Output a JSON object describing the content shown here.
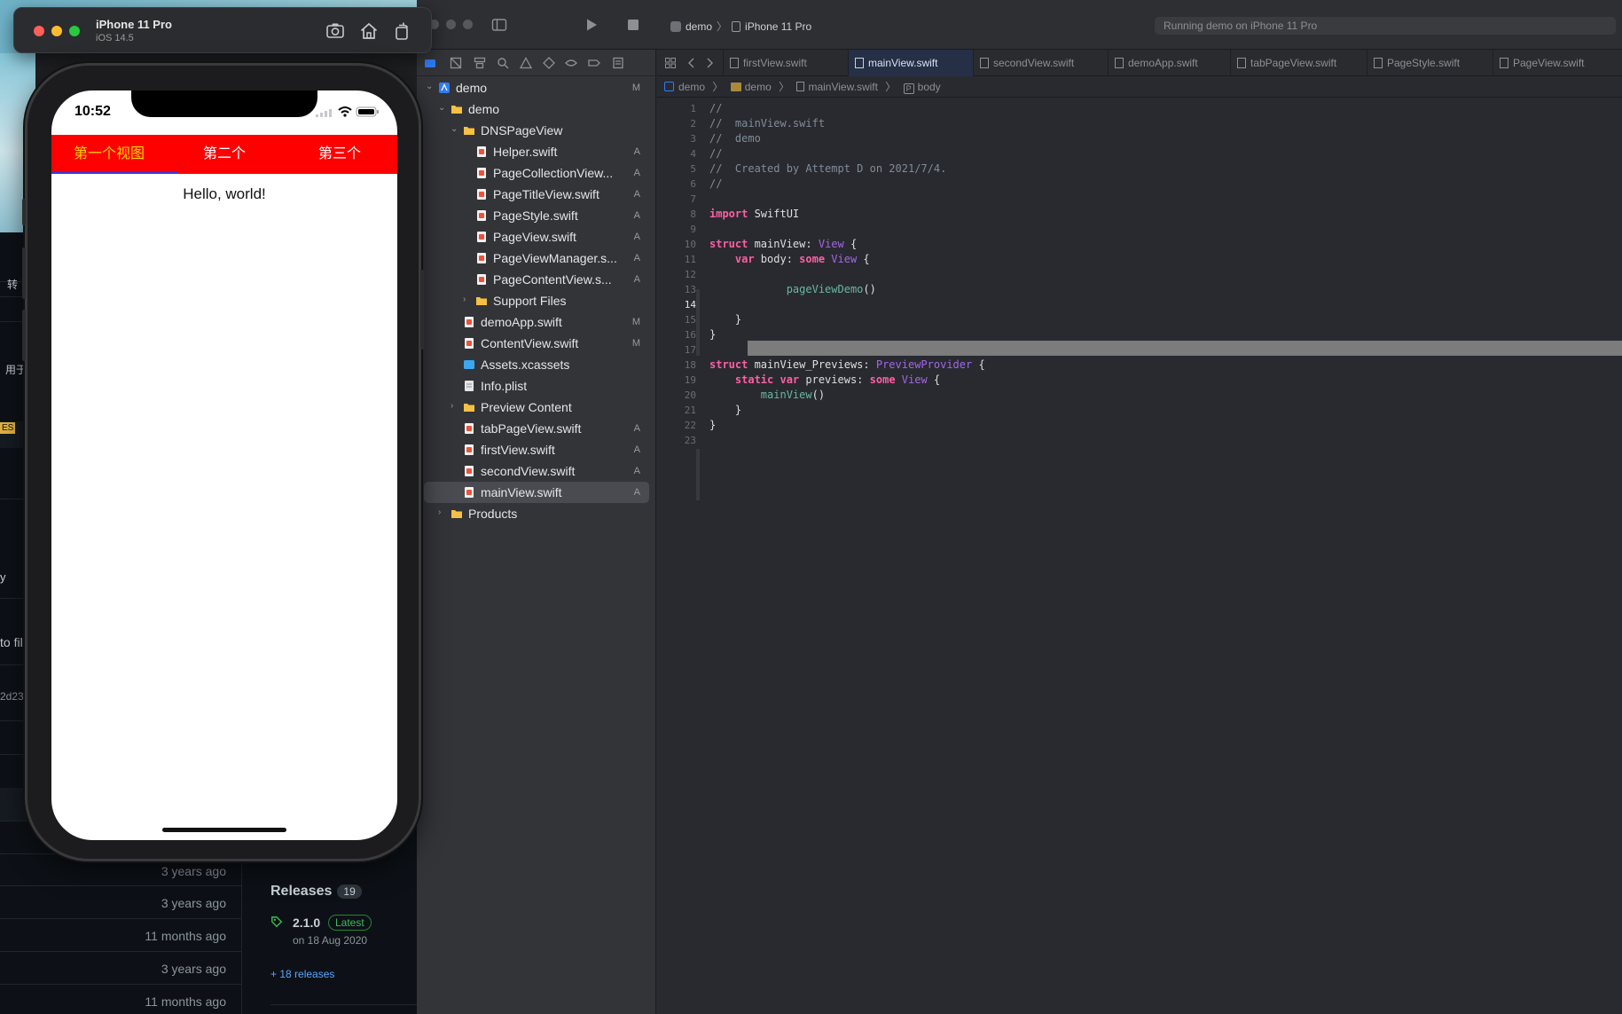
{
  "simulator": {
    "device_name": "iPhone 11 Pro",
    "os_version": "iOS 14.5",
    "status_time": "10:52",
    "tabs": [
      {
        "label": "第一个视图"
      },
      {
        "label": "第二个"
      },
      {
        "label": "第三个"
      }
    ],
    "content_text": "Hello, world!"
  },
  "background_github": {
    "snippets": [
      "转",
      "用于",
      "ES",
      "y",
      "to fil",
      "2d23"
    ],
    "times": [
      "3 years ago",
      "3 years ago",
      "11 months ago",
      "3 years ago",
      "11 months ago"
    ],
    "releases_title": "Releases",
    "releases_count": "19",
    "latest_version": "2.1.0",
    "latest_badge": "Latest",
    "latest_date": "on 18 Aug 2020",
    "more_releases": "+ 18 releases"
  },
  "xcode": {
    "scheme": "demo",
    "destination": "iPhone 11 Pro",
    "activity_status": "Running demo on iPhone 11 Pro",
    "navigator": [
      {
        "label": "demo",
        "badge": "M"
      },
      {
        "label": "demo",
        "badge": ""
      },
      {
        "label": "DNSPageView",
        "badge": ""
      },
      {
        "label": "Helper.swift",
        "badge": "A"
      },
      {
        "label": "PageCollectionView...",
        "badge": "A"
      },
      {
        "label": "PageTitleView.swift",
        "badge": "A"
      },
      {
        "label": "PageStyle.swift",
        "badge": "A"
      },
      {
        "label": "PageView.swift",
        "badge": "A"
      },
      {
        "label": "PageViewManager.s...",
        "badge": "A"
      },
      {
        "label": "PageContentView.s...",
        "badge": "A"
      },
      {
        "label": "Support Files",
        "badge": ""
      },
      {
        "label": "demoApp.swift",
        "badge": "M"
      },
      {
        "label": "ContentView.swift",
        "badge": "M"
      },
      {
        "label": "Assets.xcassets",
        "badge": ""
      },
      {
        "label": "Info.plist",
        "badge": ""
      },
      {
        "label": "Preview Content",
        "badge": ""
      },
      {
        "label": "tabPageView.swift",
        "badge": "A"
      },
      {
        "label": "firstView.swift",
        "badge": "A"
      },
      {
        "label": "secondView.swift",
        "badge": "A"
      },
      {
        "label": "mainView.swift",
        "badge": "A"
      },
      {
        "label": "Products",
        "badge": ""
      }
    ],
    "editor_tabs": [
      {
        "label": "firstView.swift"
      },
      {
        "label": "mainView.swift"
      },
      {
        "label": "secondView.swift"
      },
      {
        "label": "demoApp.swift"
      },
      {
        "label": "tabPageView.swift"
      },
      {
        "label": "PageStyle.swift"
      },
      {
        "label": "PageView.swift"
      }
    ],
    "jumpbar": [
      "demo",
      "demo",
      "mainView.swift",
      "body"
    ],
    "current_line": "14",
    "line_numbers": [
      "1",
      "2",
      "3",
      "4",
      "5",
      "6",
      "7",
      "8",
      "9",
      "10",
      "11",
      "12",
      "13",
      "14",
      "15",
      "16",
      "17",
      "18",
      "19",
      "20",
      "21",
      "22",
      "23"
    ],
    "code": {
      "l1": "//",
      "l2": "//  mainView.swift",
      "l3": "//  demo",
      "l4": "//",
      "l5": "//  Created by Attempt D on 2021/7/4.",
      "l6": "//",
      "l8_kw": "import",
      "l8_rest": " SwiftUI",
      "l10_kw": "struct",
      "l10_name": " mainView: ",
      "l10_type": "View",
      "l10_end": " {",
      "l11_kw1": "    var",
      "l11_mid": " body: ",
      "l11_kw2": "some",
      "l11_type": " View",
      "l11_end": " {",
      "l13_call": "            pageViewDemo",
      "l13_end": "()",
      "l15": "    }",
      "l16": "}",
      "l18_kw": "struct",
      "l18_name": " mainView_Previews: ",
      "l18_type": "PreviewProvider",
      "l18_end": " {",
      "l19_kw1": "    static var",
      "l19_mid": " previews: ",
      "l19_kw2": "some",
      "l19_type": " View",
      "l19_end": " {",
      "l20_call": "        mainView",
      "l20_end": "()",
      "l21": "    }",
      "l22": "}"
    }
  }
}
